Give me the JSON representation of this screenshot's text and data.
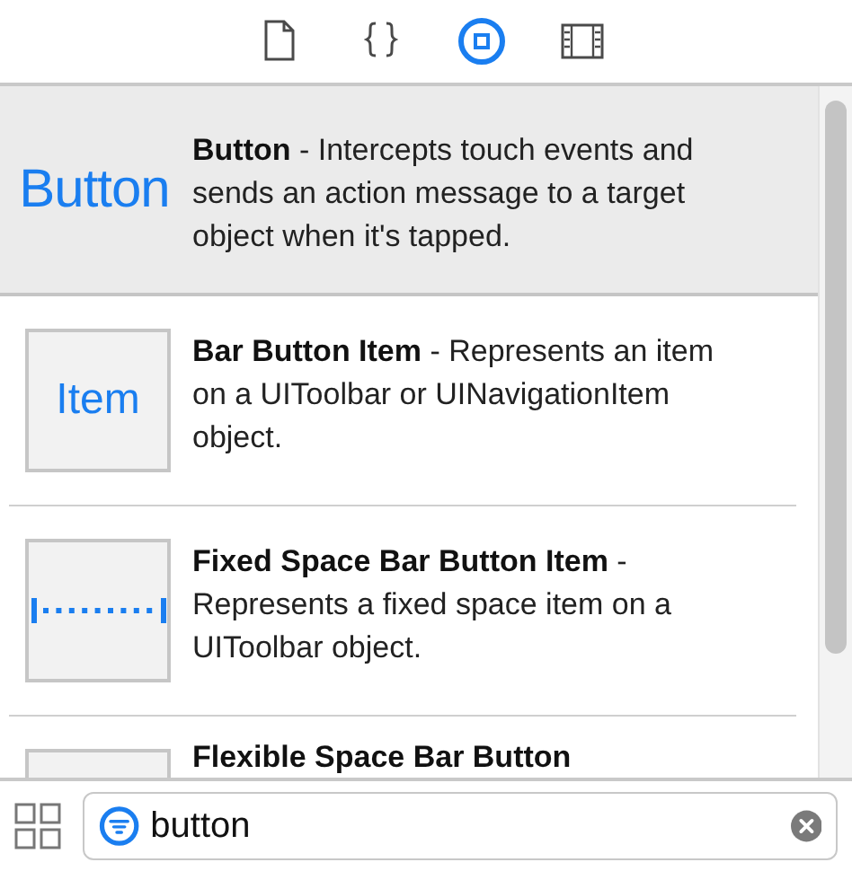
{
  "toolbar": {
    "tabs": [
      {
        "kind": "file",
        "selected": false
      },
      {
        "kind": "braces",
        "selected": false
      },
      {
        "kind": "object",
        "selected": true
      },
      {
        "kind": "media",
        "selected": false
      }
    ]
  },
  "library": {
    "items": [
      {
        "thumbnail": {
          "kind": "text",
          "label": "Button"
        },
        "description": "**Button** - Intercepts touch events and sends an action message to a target object when it's tapped.",
        "selected": true
      },
      {
        "thumbnail": {
          "kind": "framed-text",
          "label": "Item"
        },
        "description": "**Bar Button Item** - Represents an item on a UIToolbar or UINavigationItem object.",
        "selected": false
      },
      {
        "thumbnail": {
          "kind": "fixed-space"
        },
        "description": "**Fixed Space Bar Button Item** - Represents a fixed space item on a UIToolbar object.",
        "selected": false
      },
      {
        "thumbnail": {
          "kind": "blank"
        },
        "description": "**Flexible Space Bar Button**",
        "selected": false
      }
    ]
  },
  "filter": {
    "value": "button"
  }
}
